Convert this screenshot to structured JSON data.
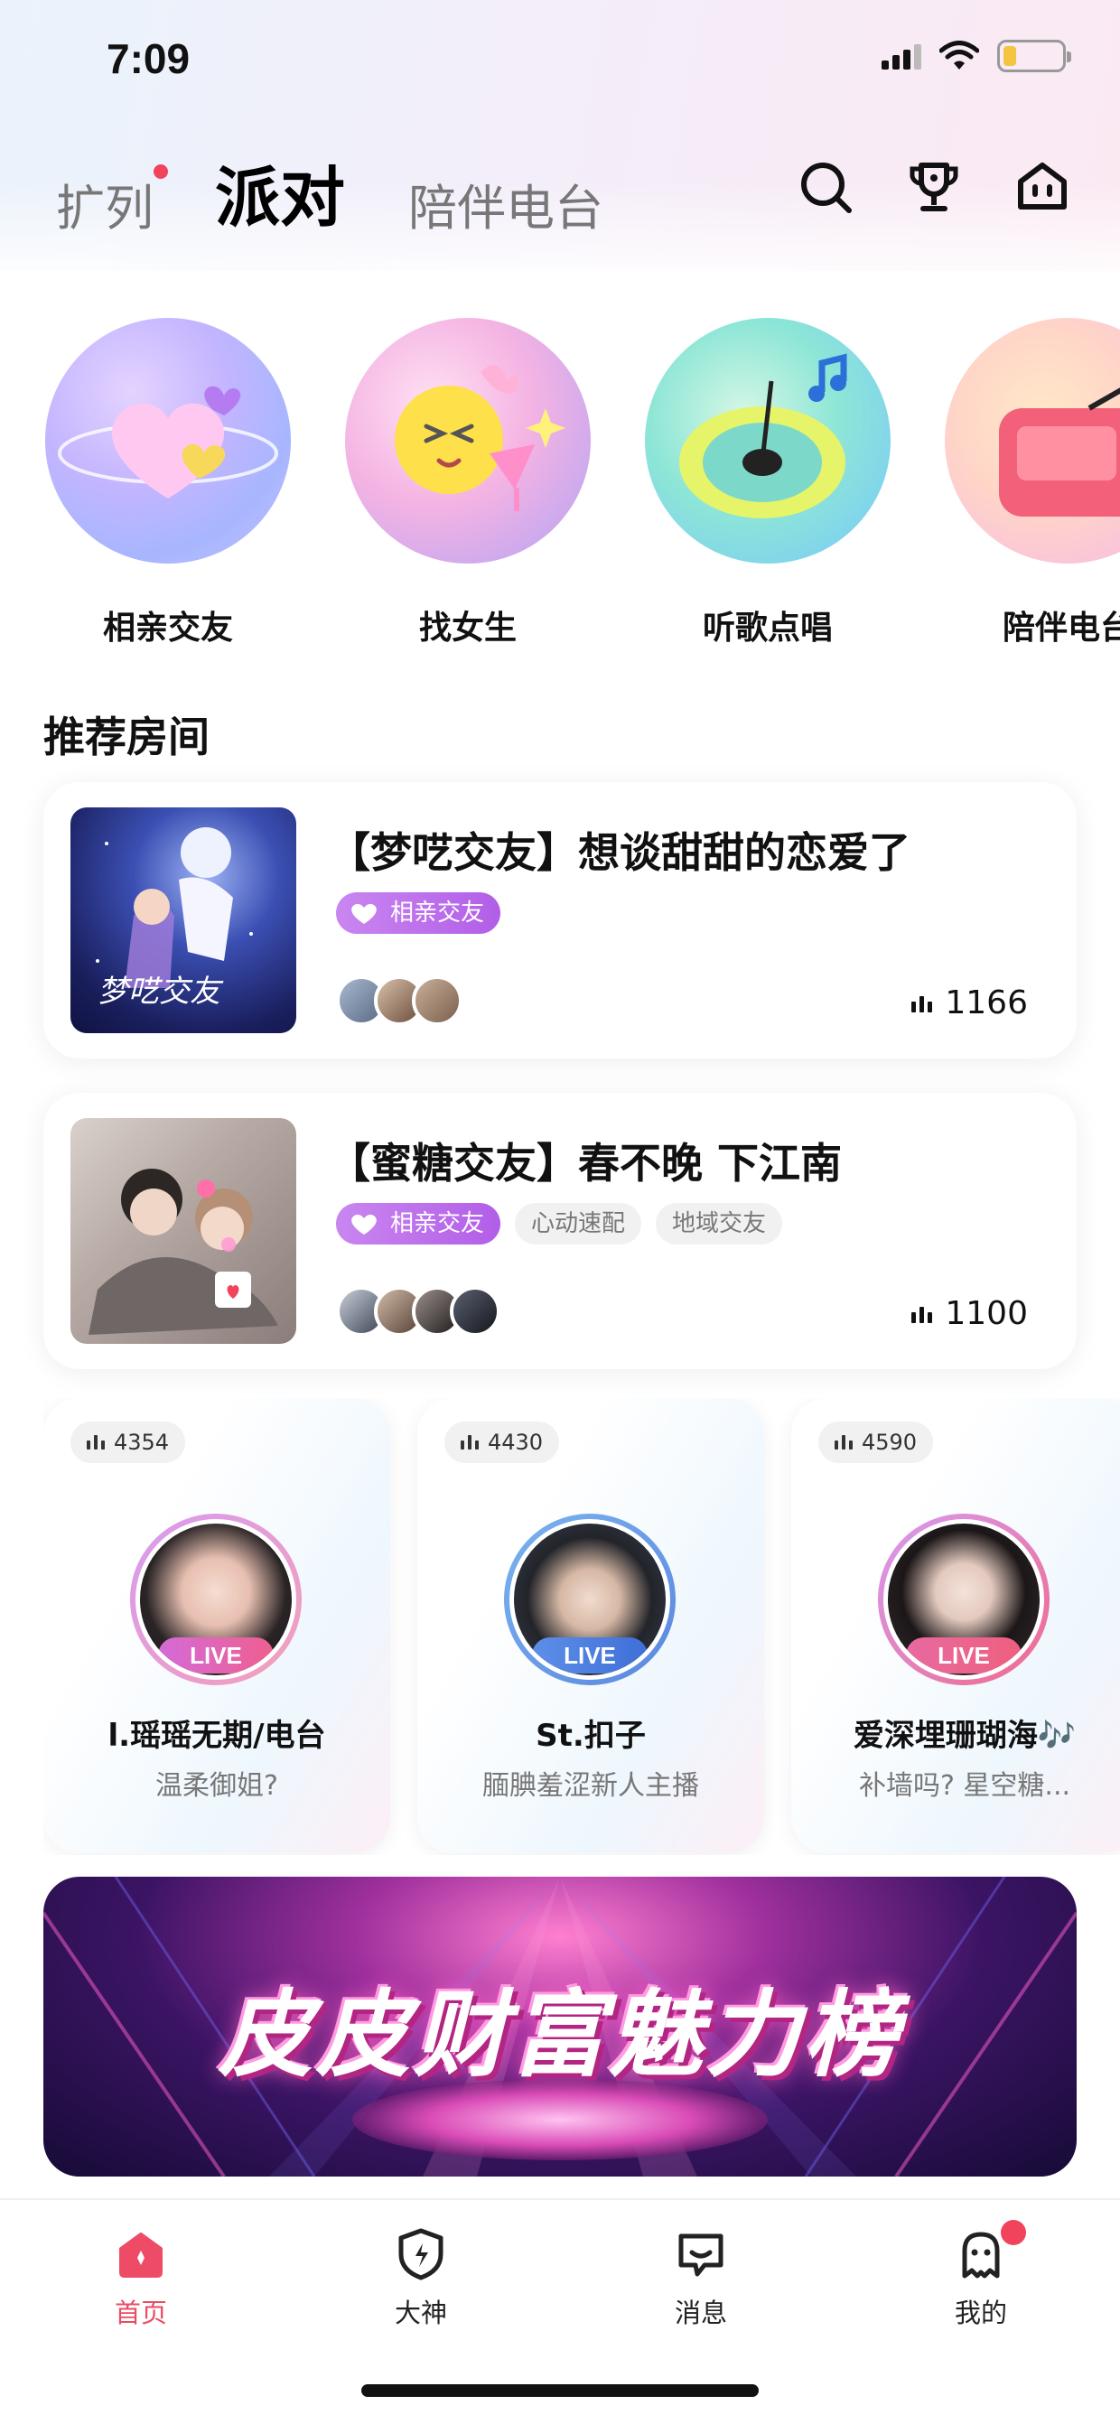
{
  "status_bar": {
    "time": "7:09"
  },
  "header": {
    "tabs": [
      {
        "label": "扩列",
        "has_dot": true
      },
      {
        "label": "派对",
        "active": true
      },
      {
        "label": "陪伴电台"
      }
    ],
    "icons": [
      "search-icon",
      "trophy-icon",
      "home-room-icon"
    ]
  },
  "categories": [
    {
      "label": "相亲交友"
    },
    {
      "label": "找女生"
    },
    {
      "label": "听歌点唱"
    },
    {
      "label": "陪伴电台"
    }
  ],
  "section": {
    "title": "推荐房间"
  },
  "rooms": [
    {
      "title": "【梦呓交友】想谈甜甜的恋爱了",
      "tags": [
        "相亲交友"
      ],
      "count": "1166"
    },
    {
      "title": "【蜜糖交友】春不晚  下江南",
      "tags": [
        "相亲交友",
        "心动速配",
        "地域交友"
      ],
      "count": "1100"
    }
  ],
  "live_cards": [
    {
      "count": "4354",
      "live_label": "LIVE",
      "name": "l.瑶瑶无期/电台",
      "desc": "温柔御姐?"
    },
    {
      "count": "4430",
      "live_label": "LIVE",
      "name": "St.扣子",
      "desc": "腼腆羞涩新人主播"
    },
    {
      "count": "4590",
      "live_label": "LIVE",
      "name": "爱深埋珊瑚海🎶",
      "desc": "补墙吗?  星空糖..."
    }
  ],
  "banner": {
    "text": "皮皮财富魅力榜"
  },
  "bottom_nav": [
    {
      "label": "首页",
      "active": true
    },
    {
      "label": "大神"
    },
    {
      "label": "消息"
    },
    {
      "label": "我的",
      "has_dot": true
    }
  ],
  "colors": {
    "accent": "#ea4c64",
    "tag_purple": "#b25ee8",
    "dot_red": "#f2435d"
  }
}
